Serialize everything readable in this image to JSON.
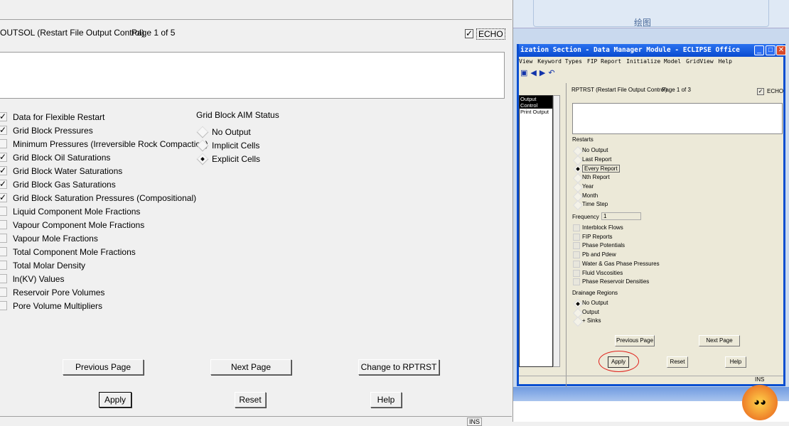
{
  "left": {
    "title": "OUTSOL (Restart File Output Control)",
    "page": "Page 1 of 5",
    "echo_label": "ECHO",
    "echo_checked": true,
    "options": [
      {
        "label": "Data for Flexible Restart",
        "checked": true
      },
      {
        "label": "Grid Block Pressures",
        "checked": true
      },
      {
        "label": "Minimum Pressures (Irreversible Rock Compaction)",
        "checked": false
      },
      {
        "label": "Grid Block Oil Saturations",
        "checked": true
      },
      {
        "label": "Grid Block Water Saturations",
        "checked": true
      },
      {
        "label": "Grid Block Gas Saturations",
        "checked": true
      },
      {
        "label": "Grid Block Saturation Pressures (Compositional)",
        "checked": true
      },
      {
        "label": "Liquid Component Mole Fractions",
        "checked": false
      },
      {
        "label": "Vapour Component Mole Fractions",
        "checked": false
      },
      {
        "label": "Vapour Mole Fractions",
        "checked": false
      },
      {
        "label": "Total Component Mole Fractions",
        "checked": false
      },
      {
        "label": "Total Molar Density",
        "checked": false
      },
      {
        "label": "ln(KV) Values",
        "checked": false
      },
      {
        "label": "Reservoir Pore Volumes",
        "checked": false
      },
      {
        "label": "Pore Volume Multipliers",
        "checked": false
      }
    ],
    "aim": {
      "title": "Grid Block AIM Status",
      "options": [
        "No Output",
        "Implicit Cells",
        "Explicit Cells"
      ],
      "selected": "Explicit Cells"
    },
    "buttons": {
      "prev": "Previous Page",
      "next": "Next Page",
      "change": "Change to RPTRST",
      "apply": "Apply",
      "reset": "Reset",
      "help": "Help"
    },
    "status": "INS"
  },
  "right": {
    "ribbon_group": "绘图",
    "window_title": "ization Section - Data Manager Module - ECLIPSE Office",
    "menu": [
      "View",
      "Keyword Types",
      "FIP Report",
      "Initialize Model",
      "GridView",
      "Help"
    ],
    "tree": [
      "Output Control",
      "Print Output"
    ],
    "title": "RPTRST (Restart File Output Control)",
    "page": "Page 1 of 3",
    "echo_label": "ECHO",
    "restarts_label": "Restarts",
    "restarts": [
      "No Output",
      "Last Report",
      "Every Report",
      "Nth Report",
      "Year",
      "Month",
      "Time Step"
    ],
    "restarts_selected": "Every Report",
    "frequency_label": "Frequency",
    "frequency": "1",
    "checks": [
      "Interblock Flows",
      "FIP Reports",
      "Phase Potentials",
      "Pb and Pdew",
      "Water & Gas Phase Pressures",
      "Fluid Viscosities",
      "Phase Reservoir Densities"
    ],
    "drainage_label": "Drainage Regions",
    "drainage": [
      "No Output",
      "Output",
      "+ Sinks"
    ],
    "drainage_selected": "No Output",
    "buttons": {
      "prev": "Previous Page",
      "next": "Next Page",
      "apply": "Apply",
      "reset": "Reset",
      "help": "Help"
    },
    "status": "INS",
    "highlight_color": "#e0201a"
  }
}
